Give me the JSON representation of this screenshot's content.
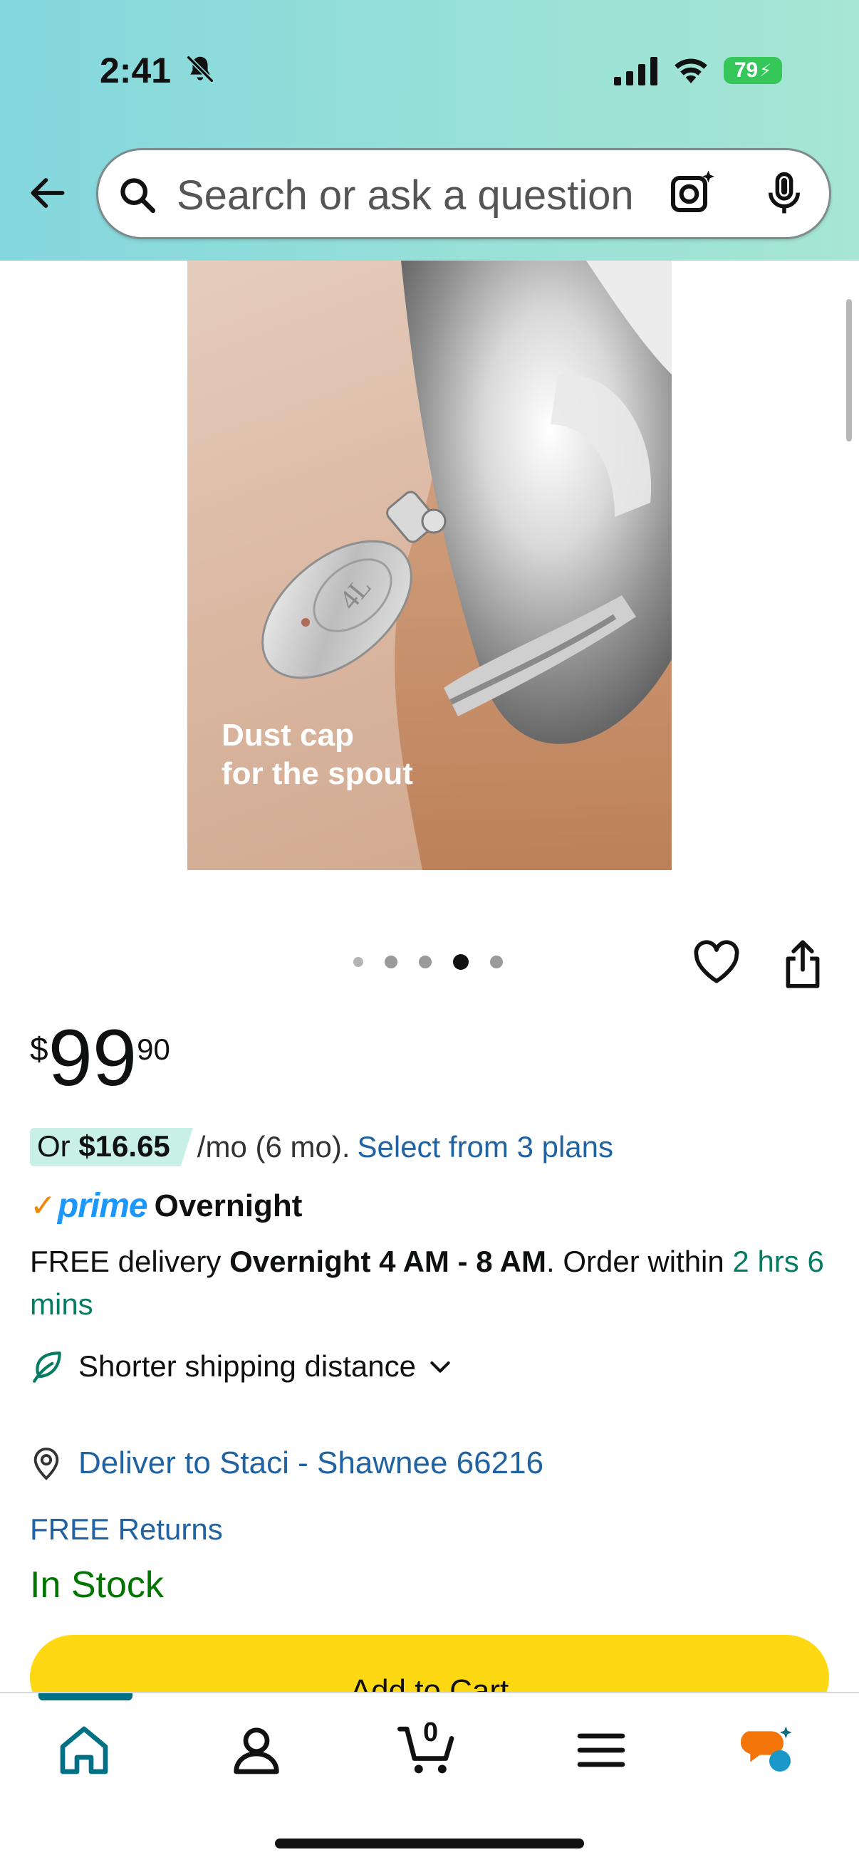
{
  "status_bar": {
    "time": "2:41",
    "battery": "79",
    "icons": [
      "bell-slash-icon",
      "cellular-signal-icon",
      "wifi-icon",
      "battery-charging-icon"
    ]
  },
  "search": {
    "placeholder": "Search or ask a question",
    "icons": [
      "back-arrow-icon",
      "search-icon",
      "camera-lens-icon",
      "microphone-icon"
    ]
  },
  "product_image": {
    "caption_line1": "Dust cap",
    "caption_line2": "for the spout",
    "engraving": "4L",
    "carousel_count": 5,
    "carousel_active_index": 3
  },
  "actions": {
    "icons": [
      "heart-icon",
      "share-icon"
    ]
  },
  "price": {
    "symbol": "$",
    "whole": "99",
    "fraction": "90"
  },
  "installment": {
    "prefix": "Or",
    "amount": "$16.65",
    "suffix": "/mo (6 mo).",
    "link": "Select from 3 plans"
  },
  "prime": {
    "check": "✓",
    "word": "prime",
    "label": "Overnight"
  },
  "delivery": {
    "text1": "FREE delivery",
    "bold": "Overnight 4 AM - 8 AM",
    "text2": ". Order within",
    "countdown": "2 hrs 6 mins"
  },
  "shipping": {
    "label": "Shorter shipping distance"
  },
  "deliver_to": {
    "label": "Deliver to Staci - Shawnee 66216"
  },
  "returns": {
    "label": "FREE Returns"
  },
  "stock": {
    "label": "In Stock"
  },
  "cart_button": {
    "label": "Add to Cart"
  },
  "bottom_nav": {
    "cart_count": "0",
    "items": [
      "home-icon",
      "account-icon",
      "cart-icon",
      "menu-icon",
      "rufus-icon"
    ],
    "accent_color": "#007185"
  },
  "colors": {
    "link": "#2162a1",
    "in_stock": "#007600",
    "button": "#ffd814",
    "prime_blue": "#1a98ff",
    "prime_check": "#f08804"
  }
}
